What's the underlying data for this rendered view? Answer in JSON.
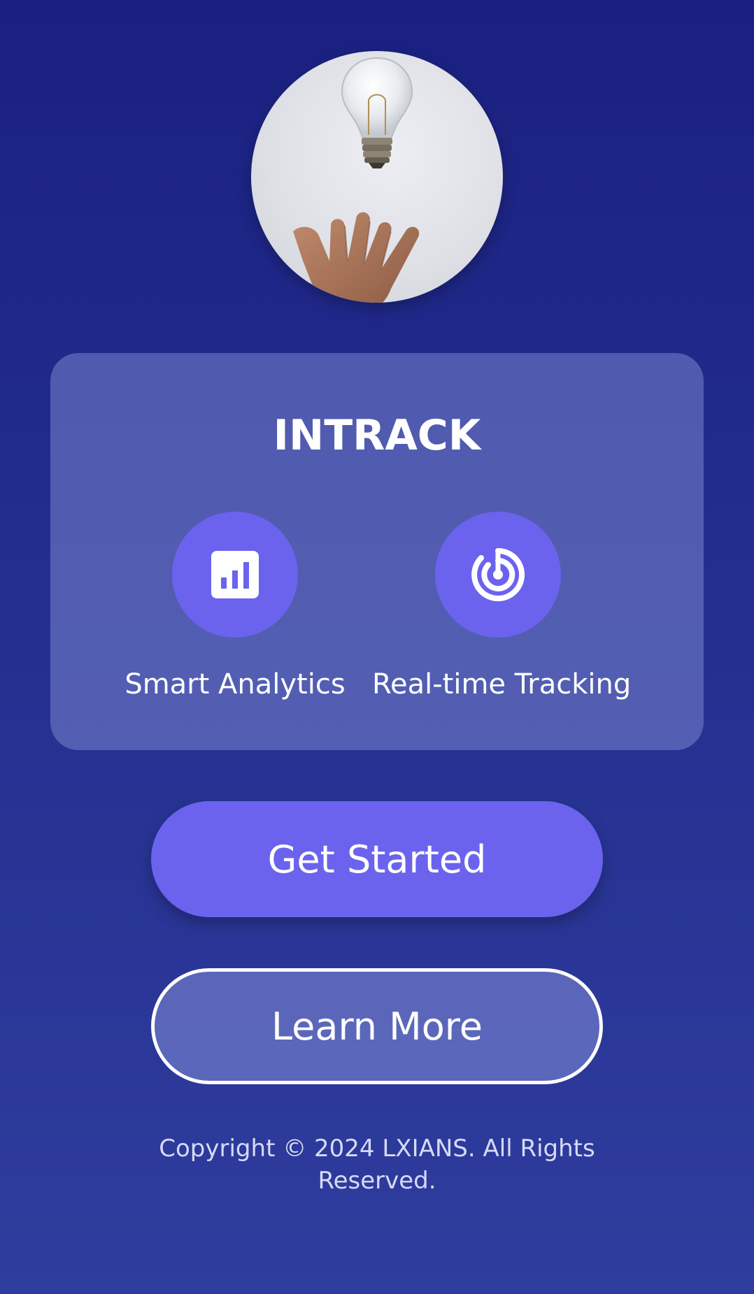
{
  "app": {
    "brand_name": "INTRACK"
  },
  "hero": {
    "image": "lightbulb-over-hand-photo"
  },
  "features": [
    {
      "label": "Smart Analytics",
      "icon": "analytics-chart-icon"
    },
    {
      "label": "Real-time Tracking",
      "icon": "radar-tracking-icon"
    }
  ],
  "actions": {
    "primary_label": "Get Started",
    "secondary_label": "Learn More"
  },
  "footer": {
    "copyright": "Copyright © 2024 LXIANS. All Rights Reserved."
  },
  "colors": {
    "background_top": "#1a2080",
    "background_bottom": "#2f3d9e",
    "accent": "#6b63ee",
    "card": "rgba(140,150,220,0.45)",
    "text": "#ffffff"
  }
}
